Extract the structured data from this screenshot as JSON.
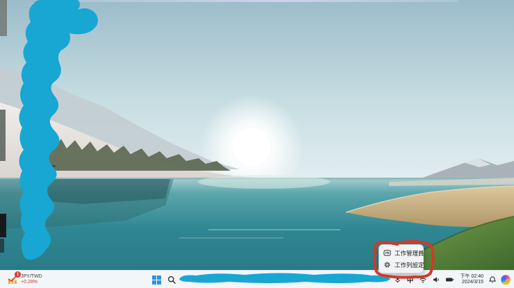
{
  "context_menu": {
    "items": [
      {
        "icon": "task-manager-icon",
        "label": "工作管理員"
      },
      {
        "icon": "gear-icon",
        "label": "工作列設定"
      }
    ]
  },
  "taskbar": {
    "widget": {
      "icon": "stock-chart-icon",
      "badge": "1",
      "symbol": "JPY/TWD",
      "change": "+0.28%"
    },
    "start_icon": "windows-logo",
    "search_icon": "search-icon",
    "tray": {
      "chevron_icon": "chevron-up-icon",
      "mic_icon": "microphone-icon",
      "ime_label": "中",
      "wifi_icon": "wifi-icon",
      "volume_icon": "volume-icon",
      "battery_icon": "battery-icon",
      "time": "下午 02:40",
      "date": "2024/3/15",
      "bell_icon": "notification-bell-icon",
      "copilot_icon": "copilot-icon"
    }
  },
  "annotations": {
    "redaction_scribble_color": "#18a6d3",
    "highlight_circle_color": "#d2392a"
  },
  "colors": {
    "taskbar_bg": "#f2f6f9",
    "menu_bg": "#f1f3f5",
    "windows_logo_blue": "#3092e0",
    "widget_change_red": "#c23a2e",
    "sky_top": "#9cbcca",
    "lake_teal": "#2f8793",
    "dry_grass_tan": "#c9b283",
    "green_grass": "#4f8238"
  }
}
